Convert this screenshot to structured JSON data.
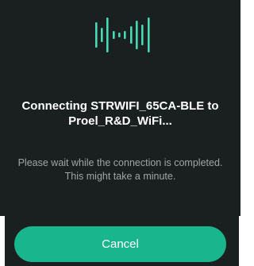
{
  "dialog": {
    "icon": "wifi-waveform-icon",
    "accent_color": "#49d9b6",
    "title": "Connecting STRWIFI_65CA-BLE to Proel_R&D_WiFi...",
    "message": "Please wait while the connection is completed. This might take a minute.",
    "cancel_label": "Cancel",
    "button_color": "#19b58d"
  }
}
